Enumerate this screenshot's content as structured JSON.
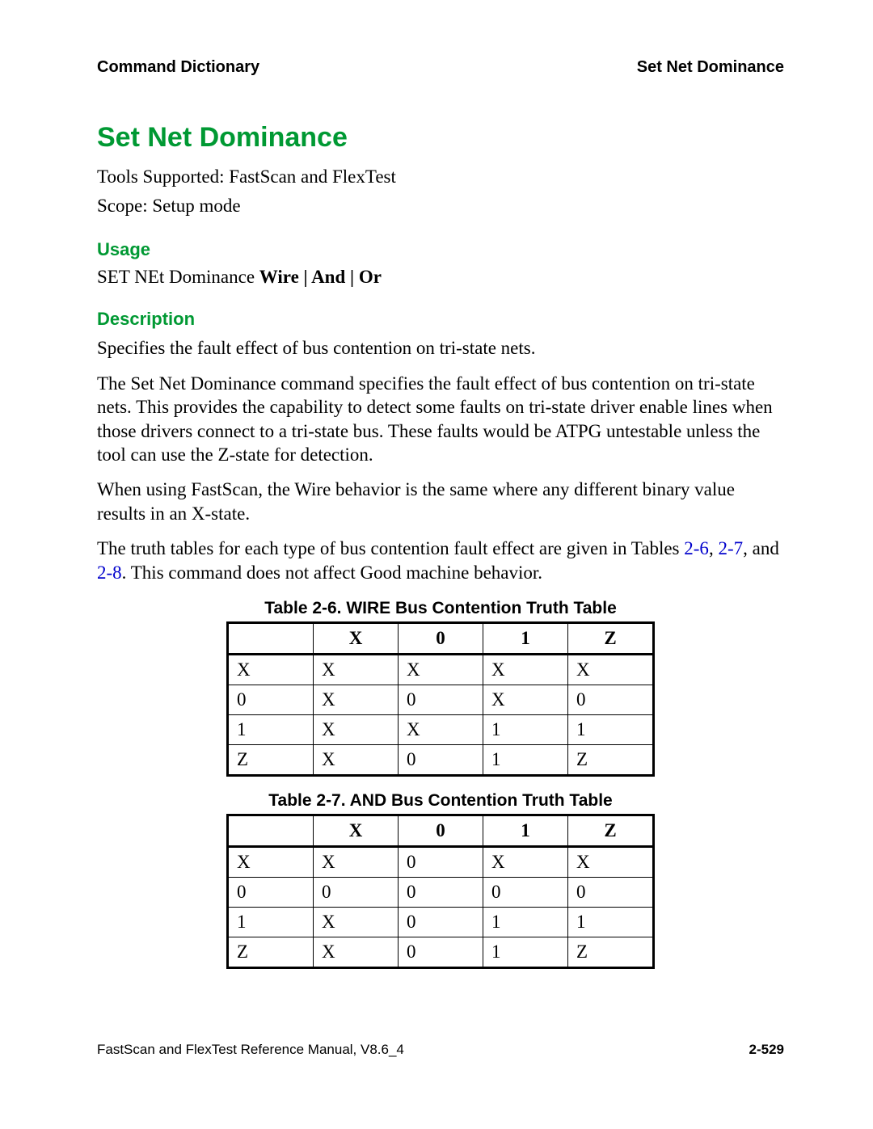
{
  "header": {
    "left": "Command Dictionary",
    "right": "Set Net Dominance"
  },
  "title": "Set Net Dominance",
  "tools_line": "Tools Supported: FastScan and FlexTest",
  "scope_line": "Scope: Setup mode",
  "usage": {
    "heading": "Usage",
    "prefix": "SET NEt Dominance ",
    "bold": "Wire | And | Or"
  },
  "description": {
    "heading": "Description",
    "p1": "Specifies the fault effect of bus contention on tri-state nets.",
    "p2": "The Set Net Dominance command specifies the fault effect of bus contention on tri-state nets. This provides the capability to detect some faults on tri-state driver enable lines when those drivers connect to a tri-state bus. These faults would be ATPG untestable unless the tool can use the Z-state for detection.",
    "p3": "When using FastScan, the Wire behavior is the same where any different binary value results in an X-state.",
    "p4_a": "The truth tables for each type of bus contention fault effect are given in Tables ",
    "xref1": "2-6",
    "sep1": ", ",
    "xref2": "2-7",
    "sep2": ", and ",
    "xref3": "2-8",
    "p4_b": ". This command does not affect Good machine behavior."
  },
  "tables": {
    "wire": {
      "caption": "Table 2-6. WIRE Bus Contention Truth Table",
      "head": [
        "",
        "X",
        "0",
        "1",
        "Z"
      ],
      "rows": [
        [
          "X",
          "X",
          "X",
          "X",
          "X"
        ],
        [
          "0",
          "X",
          "0",
          "X",
          "0"
        ],
        [
          "1",
          "X",
          "X",
          "1",
          "1"
        ],
        [
          "Z",
          "X",
          "0",
          "1",
          "Z"
        ]
      ]
    },
    "and": {
      "caption": "Table 2-7. AND Bus Contention Truth Table",
      "head": [
        "",
        "X",
        "0",
        "1",
        "Z"
      ],
      "rows": [
        [
          "X",
          "X",
          "0",
          "X",
          "X"
        ],
        [
          "0",
          "0",
          "0",
          "0",
          "0"
        ],
        [
          "1",
          "X",
          "0",
          "1",
          "1"
        ],
        [
          "Z",
          "X",
          "0",
          "1",
          "Z"
        ]
      ]
    }
  },
  "footer": {
    "left": "FastScan and FlexTest Reference Manual, V8.6_4",
    "right": "2-529"
  }
}
